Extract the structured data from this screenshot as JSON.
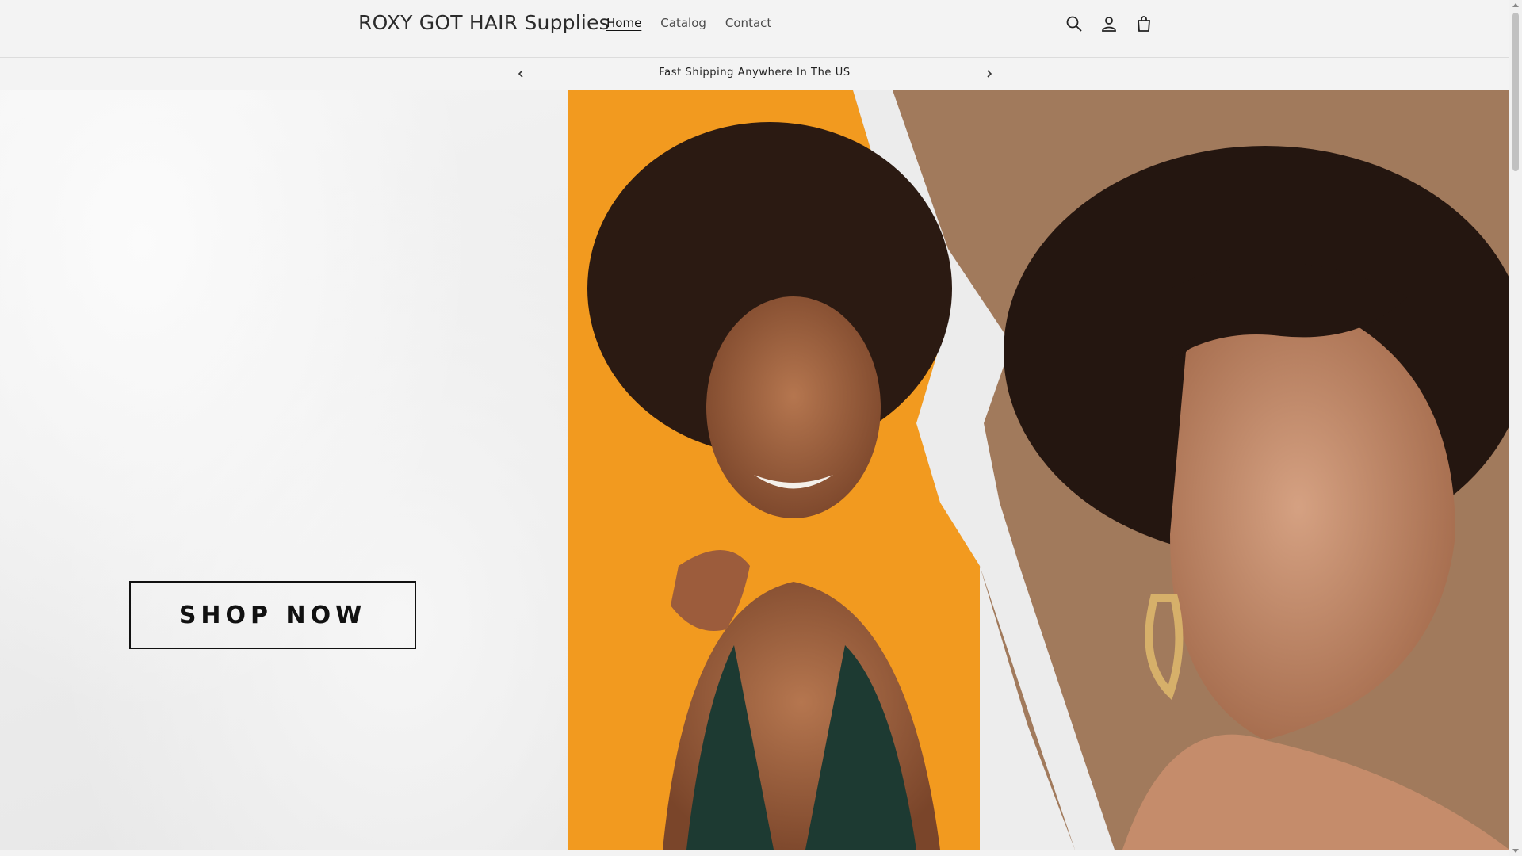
{
  "header": {
    "brand": "ROXY GOT HAIR Supplies",
    "nav": [
      {
        "label": "Home",
        "active": true
      },
      {
        "label": "Catalog",
        "active": false
      },
      {
        "label": "Contact",
        "active": false
      }
    ],
    "icons": [
      "search-icon",
      "account-icon",
      "cart-icon"
    ]
  },
  "announcement": {
    "text": "Fast Shipping Anywhere In The US",
    "prev_icon": "chevron-left-icon",
    "next_icon": "chevron-right-icon"
  },
  "hero": {
    "cta_label": "SHOP NOW"
  },
  "colors": {
    "background": "#f3f3f3",
    "text": "#121212",
    "orange": "#f29a1f",
    "brown": "#a17a5c",
    "dark_green": "#1d3a32"
  }
}
